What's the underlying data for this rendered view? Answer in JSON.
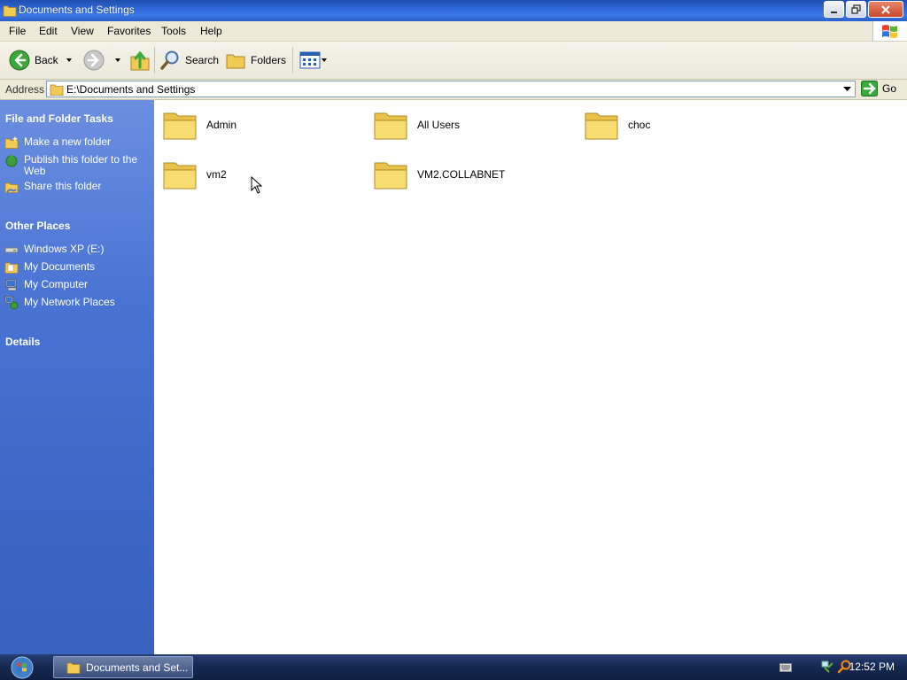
{
  "window": {
    "title": "Documents and Settings",
    "controls": [
      "minimize",
      "restore",
      "close"
    ]
  },
  "menu": [
    "File",
    "Edit",
    "View",
    "Favorites",
    "Tools",
    "Help"
  ],
  "toolbar": {
    "back_label": "Back",
    "search_label": "Search",
    "folders_label": "Folders"
  },
  "address": {
    "label": "Address",
    "value": "E:\\Documents and Settings",
    "go_label": "Go"
  },
  "tasks": {
    "file_folder": {
      "title": "File and Folder Tasks",
      "items": [
        "Make a new folder",
        "Publish this folder to the Web",
        "Share this folder"
      ]
    },
    "other_places": {
      "title": "Other Places",
      "items": [
        "Windows XP (E:)",
        "My Documents",
        "My Computer",
        "My Network Places"
      ]
    },
    "details": {
      "title": "Details"
    }
  },
  "folders": [
    "Admin",
    "All Users",
    "choc",
    "vm2",
    "VM2.COLLABNET"
  ],
  "taskbar": {
    "window_button": "Documents and Set...",
    "clock": "12:52 PM"
  },
  "colors": {
    "titlebar": "#2e67d6",
    "pane": "#4a74d4",
    "folder": "#f4d35e",
    "taskbar": "#15284f"
  }
}
